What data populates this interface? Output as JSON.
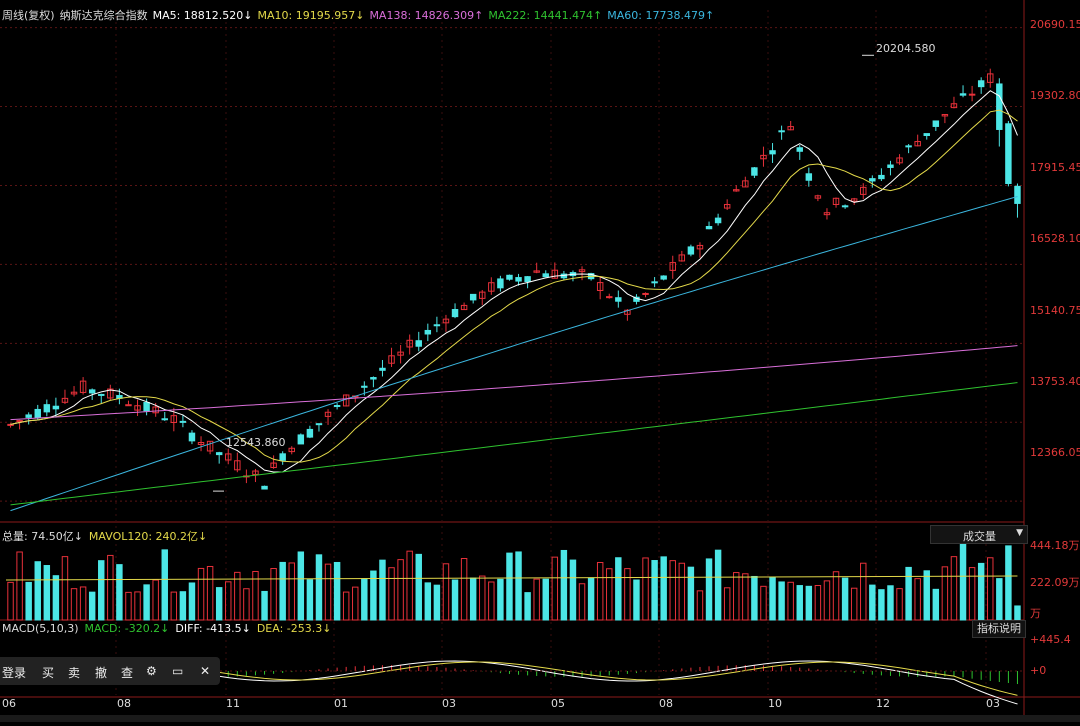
{
  "legend": {
    "title": "周线(复权)",
    "name": "纳斯达克综合指数",
    "ma5": "MA5: 18812.520↓",
    "ma10": "MA10: 19195.957↓",
    "ma138": "MA138: 14826.309↑",
    "ma222": "MA222: 14441.474↑",
    "ma60": "MA60: 17738.479↑"
  },
  "price_axis": [
    "20690.152",
    "19302.803",
    "17915.453",
    "16528.104",
    "15140.754",
    "13753.405",
    "12366.055"
  ],
  "extremes": {
    "high": "20204.580",
    "low": "12543.860"
  },
  "volume_panel": {
    "legend_total": "总量: 74.50亿↓",
    "legend_mavol": "MAVOL120: 240.2亿↓",
    "dropdown_label": "成交量",
    "axis": [
      "444.18万",
      "222.09万",
      "万"
    ]
  },
  "macd_panel": {
    "legend_title": "MACD(5,10,3)",
    "legend_macd": "MACD: -320.2↓",
    "legend_diff": "DIFF: -413.5↓",
    "legend_dea": "DEA: -253.3↓",
    "axis": [
      "+445.4",
      "+0"
    ],
    "button_label": "指标说明"
  },
  "toolbar": {
    "login": "登录",
    "buy": "买",
    "sell": "卖",
    "cancel": "撤",
    "query": "查"
  },
  "time_axis": [
    "06",
    "08",
    "11",
    "01",
    "03",
    "05",
    "08",
    "10",
    "12",
    "03"
  ],
  "colors": {
    "up": "#e8313a",
    "down": "#4ce6e6",
    "ma5": "#ffffff",
    "ma10": "#e3d94a",
    "ma138": "#d96fd9",
    "ma222": "#2fc22f",
    "ma60": "#3bb6de"
  },
  "chart_data": {
    "type": "candlestick",
    "title": "纳斯达克综合指数",
    "series": [
      {
        "name": "MA5",
        "last": 18812.52
      },
      {
        "name": "MA10",
        "last": 19195.957
      },
      {
        "name": "MA138",
        "last": 14826.309
      },
      {
        "name": "MA222",
        "last": 14441.474
      },
      {
        "name": "MA60",
        "last": 17738.479
      }
    ],
    "ylim": [
      12000,
      21000
    ],
    "high": 20204.58,
    "low": 12543.86,
    "volume_last": "74.50亿",
    "macd": {
      "macd": -320.2,
      "diff": -413.5,
      "dea": -253.3
    }
  }
}
